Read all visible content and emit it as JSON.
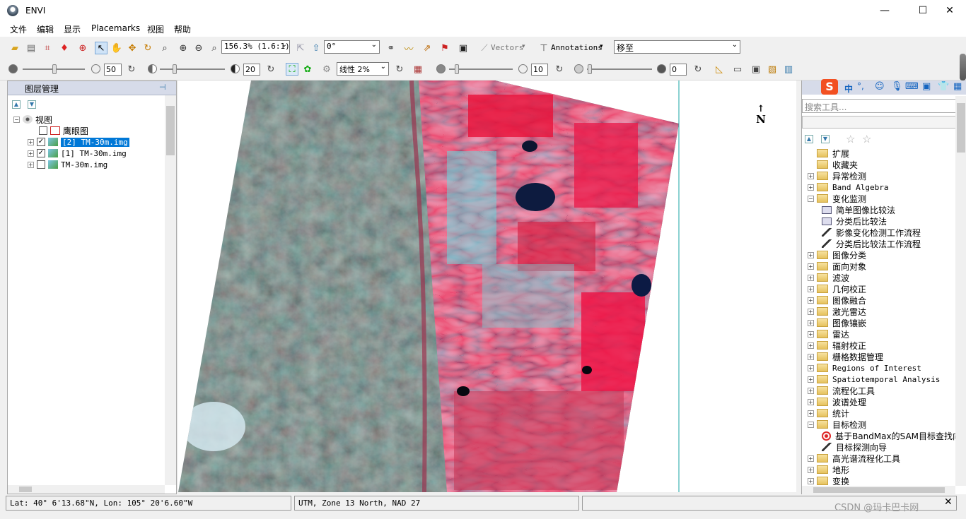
{
  "window": {
    "title": "ENVI",
    "minimize": "—",
    "maximize": "☐",
    "close": "✕"
  },
  "menu": [
    "文件",
    "编辑",
    "显示",
    "Placemarks",
    "视图",
    "帮助"
  ],
  "toolbar": {
    "zoom_value": "156.3% (1.6:1)",
    "rotation_value": "0°",
    "vectors_label": "Vectors",
    "annotations_label": "Annotations",
    "goto_label": "移至",
    "brightness_value": "50",
    "contrast_value": "20",
    "stretch_value": "线性 2%",
    "sharpen_value": "10",
    "transparency_value": "0"
  },
  "layer_panel": {
    "title": "图层管理",
    "root": "视图",
    "items": [
      {
        "label": "鹰眼图",
        "checked": false,
        "selected": false
      },
      {
        "label": "[2] TM-30m.img",
        "checked": true,
        "selected": true
      },
      {
        "label": "[1] TM-30m.img",
        "checked": true,
        "selected": false
      },
      {
        "label": "TM-30m.img",
        "checked": false,
        "selected": false
      }
    ]
  },
  "map": {
    "north_label": "N"
  },
  "toolbox": {
    "search_placeholder": "搜索工具...",
    "items": [
      {
        "label": "扩展",
        "level": 0,
        "type": "folder",
        "expand": ""
      },
      {
        "label": "收藏夹",
        "level": 0,
        "type": "folder",
        "expand": ""
      },
      {
        "label": "异常检测",
        "level": 0,
        "type": "folder",
        "expand": "+"
      },
      {
        "label": "Band Algebra",
        "level": 0,
        "type": "folder",
        "expand": "+"
      },
      {
        "label": "变化监测",
        "level": 0,
        "type": "folder",
        "expand": "−"
      },
      {
        "label": "简单图像比较法",
        "level": 1,
        "type": "tool",
        "expand": ""
      },
      {
        "label": "分类后比较法",
        "level": 1,
        "type": "tool",
        "expand": ""
      },
      {
        "label": "影像变化检测工作流程",
        "level": 1,
        "type": "wand",
        "expand": ""
      },
      {
        "label": "分类后比较法工作流程",
        "level": 1,
        "type": "wand",
        "expand": ""
      },
      {
        "label": "图像分类",
        "level": 0,
        "type": "folder",
        "expand": "+"
      },
      {
        "label": "面向对象",
        "level": 0,
        "type": "folder",
        "expand": "+"
      },
      {
        "label": "滤波",
        "level": 0,
        "type": "folder",
        "expand": "+"
      },
      {
        "label": "几何校正",
        "level": 0,
        "type": "folder",
        "expand": "+"
      },
      {
        "label": "图像融合",
        "level": 0,
        "type": "folder",
        "expand": "+"
      },
      {
        "label": "激光雷达",
        "level": 0,
        "type": "folder",
        "expand": "+"
      },
      {
        "label": "图像镶嵌",
        "level": 0,
        "type": "folder",
        "expand": "+"
      },
      {
        "label": "雷达",
        "level": 0,
        "type": "folder",
        "expand": "+"
      },
      {
        "label": "辐射校正",
        "level": 0,
        "type": "folder",
        "expand": "+"
      },
      {
        "label": "栅格数据管理",
        "level": 0,
        "type": "folder",
        "expand": "+"
      },
      {
        "label": "Regions of Interest",
        "level": 0,
        "type": "folder",
        "expand": "+"
      },
      {
        "label": "Spatiotemporal Analysis",
        "level": 0,
        "type": "folder",
        "expand": "+"
      },
      {
        "label": "流程化工具",
        "level": 0,
        "type": "folder",
        "expand": "+"
      },
      {
        "label": "波谱处理",
        "level": 0,
        "type": "folder",
        "expand": "+"
      },
      {
        "label": "统计",
        "level": 0,
        "type": "folder",
        "expand": "+"
      },
      {
        "label": "目标检测",
        "level": 0,
        "type": "folder",
        "expand": "−"
      },
      {
        "label": "基于BandMax的SAM目标查找向导",
        "level": 1,
        "type": "target",
        "expand": ""
      },
      {
        "label": "目标探测向导",
        "level": 1,
        "type": "wand",
        "expand": ""
      },
      {
        "label": "高光谱流程化工具",
        "level": 0,
        "type": "folder",
        "expand": "+"
      },
      {
        "label": "地形",
        "level": 0,
        "type": "folder",
        "expand": "+"
      },
      {
        "label": "变换",
        "level": 0,
        "type": "folder",
        "expand": "+"
      }
    ]
  },
  "status": {
    "latlon": "Lat: 40° 6'13.68\"N, Lon: 105° 20'6.60\"W",
    "projection": "UTM, Zone 13 North, NAD 27",
    "watermark": "CSDN @玛卡巴卡网"
  },
  "colors": {
    "accent_selection": "#0078d7",
    "panel_header": "#d6dbe9",
    "red_veg": "#e8123a"
  }
}
